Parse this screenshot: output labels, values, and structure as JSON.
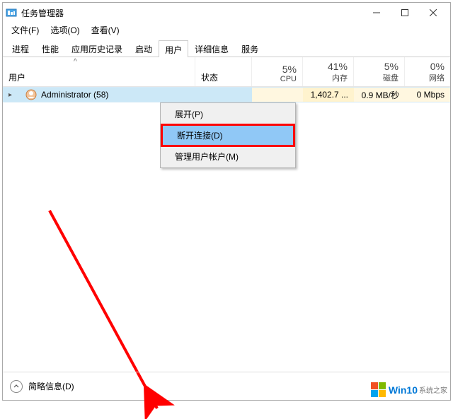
{
  "window": {
    "title": "任务管理器",
    "controls": {
      "minimize": "—",
      "maximize": "☐",
      "close": "✕"
    }
  },
  "menubar": {
    "file": "文件(F)",
    "options": "选项(O)",
    "view": "查看(V)"
  },
  "tabs": {
    "processes": "进程",
    "performance": "性能",
    "apphistory": "应用历史记录",
    "startup": "启动",
    "users": "用户",
    "details": "详细信息",
    "services": "服务"
  },
  "columns": {
    "user": "用户",
    "status": "状态",
    "cpu": {
      "pct": "5%",
      "label": "CPU"
    },
    "mem": {
      "pct": "41%",
      "label": "内存"
    },
    "disk": {
      "pct": "5%",
      "label": "磁盘"
    },
    "net": {
      "pct": "0%",
      "label": "网络"
    },
    "sort_indicator": "^"
  },
  "user_row": {
    "name": "Administrator (58)",
    "cpu": "",
    "mem": "1,402.7 ...",
    "disk": "0.9 MB/秒",
    "net": "0 Mbps"
  },
  "context_menu": {
    "expand": "展开(P)",
    "disconnect": "断开连接(D)",
    "manage": "管理用户帐户(M)"
  },
  "footer": {
    "brief": "简略信息(D)"
  },
  "watermark": {
    "brand": "Win10",
    "sub": "系统之家"
  }
}
